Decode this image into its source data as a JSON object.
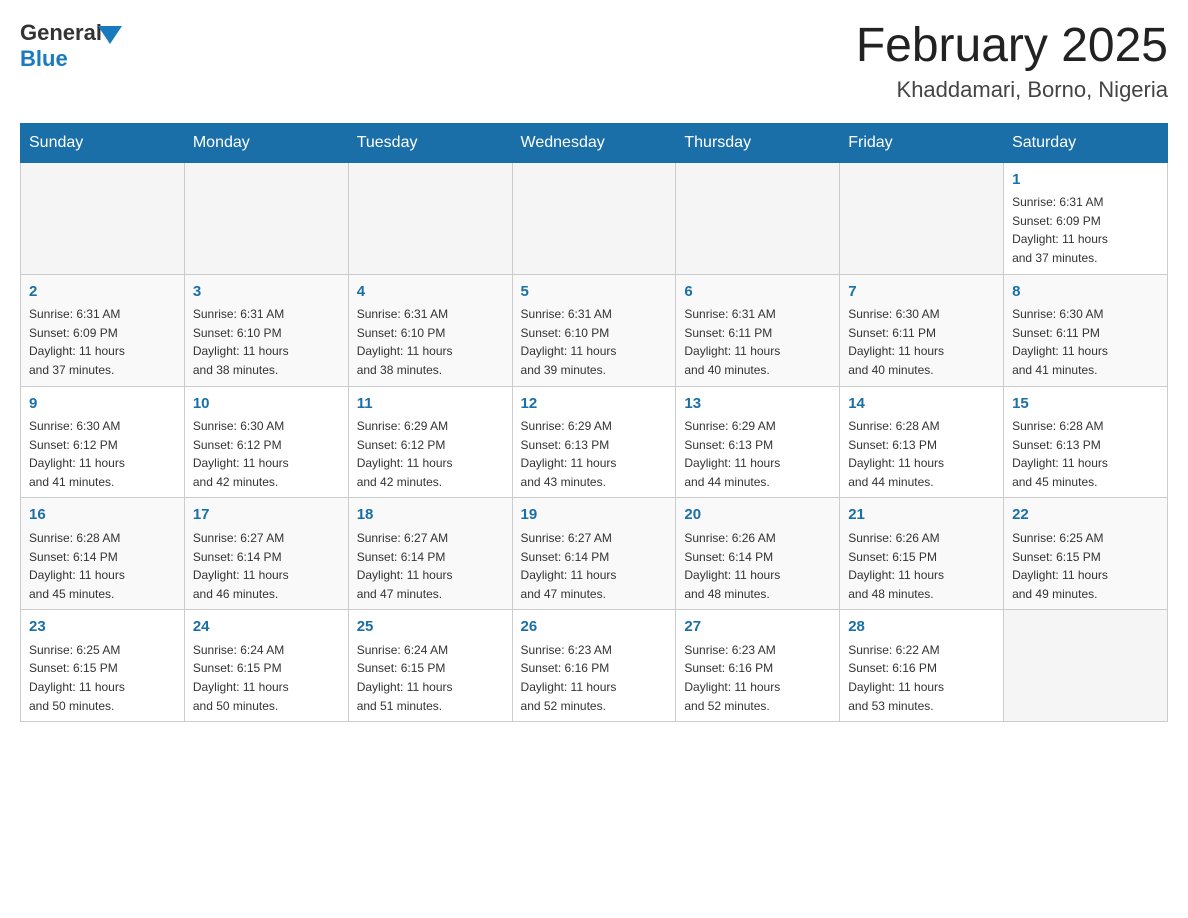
{
  "logo": {
    "general": "General",
    "blue": "Blue"
  },
  "title": "February 2025",
  "location": "Khaddamari, Borno, Nigeria",
  "days_of_week": [
    "Sunday",
    "Monday",
    "Tuesday",
    "Wednesday",
    "Thursday",
    "Friday",
    "Saturday"
  ],
  "weeks": [
    [
      {
        "day": "",
        "info": ""
      },
      {
        "day": "",
        "info": ""
      },
      {
        "day": "",
        "info": ""
      },
      {
        "day": "",
        "info": ""
      },
      {
        "day": "",
        "info": ""
      },
      {
        "day": "",
        "info": ""
      },
      {
        "day": "1",
        "info": "Sunrise: 6:31 AM\nSunset: 6:09 PM\nDaylight: 11 hours\nand 37 minutes."
      }
    ],
    [
      {
        "day": "2",
        "info": "Sunrise: 6:31 AM\nSunset: 6:09 PM\nDaylight: 11 hours\nand 37 minutes."
      },
      {
        "day": "3",
        "info": "Sunrise: 6:31 AM\nSunset: 6:10 PM\nDaylight: 11 hours\nand 38 minutes."
      },
      {
        "day": "4",
        "info": "Sunrise: 6:31 AM\nSunset: 6:10 PM\nDaylight: 11 hours\nand 38 minutes."
      },
      {
        "day": "5",
        "info": "Sunrise: 6:31 AM\nSunset: 6:10 PM\nDaylight: 11 hours\nand 39 minutes."
      },
      {
        "day": "6",
        "info": "Sunrise: 6:31 AM\nSunset: 6:11 PM\nDaylight: 11 hours\nand 40 minutes."
      },
      {
        "day": "7",
        "info": "Sunrise: 6:30 AM\nSunset: 6:11 PM\nDaylight: 11 hours\nand 40 minutes."
      },
      {
        "day": "8",
        "info": "Sunrise: 6:30 AM\nSunset: 6:11 PM\nDaylight: 11 hours\nand 41 minutes."
      }
    ],
    [
      {
        "day": "9",
        "info": "Sunrise: 6:30 AM\nSunset: 6:12 PM\nDaylight: 11 hours\nand 41 minutes."
      },
      {
        "day": "10",
        "info": "Sunrise: 6:30 AM\nSunset: 6:12 PM\nDaylight: 11 hours\nand 42 minutes."
      },
      {
        "day": "11",
        "info": "Sunrise: 6:29 AM\nSunset: 6:12 PM\nDaylight: 11 hours\nand 42 minutes."
      },
      {
        "day": "12",
        "info": "Sunrise: 6:29 AM\nSunset: 6:13 PM\nDaylight: 11 hours\nand 43 minutes."
      },
      {
        "day": "13",
        "info": "Sunrise: 6:29 AM\nSunset: 6:13 PM\nDaylight: 11 hours\nand 44 minutes."
      },
      {
        "day": "14",
        "info": "Sunrise: 6:28 AM\nSunset: 6:13 PM\nDaylight: 11 hours\nand 44 minutes."
      },
      {
        "day": "15",
        "info": "Sunrise: 6:28 AM\nSunset: 6:13 PM\nDaylight: 11 hours\nand 45 minutes."
      }
    ],
    [
      {
        "day": "16",
        "info": "Sunrise: 6:28 AM\nSunset: 6:14 PM\nDaylight: 11 hours\nand 45 minutes."
      },
      {
        "day": "17",
        "info": "Sunrise: 6:27 AM\nSunset: 6:14 PM\nDaylight: 11 hours\nand 46 minutes."
      },
      {
        "day": "18",
        "info": "Sunrise: 6:27 AM\nSunset: 6:14 PM\nDaylight: 11 hours\nand 47 minutes."
      },
      {
        "day": "19",
        "info": "Sunrise: 6:27 AM\nSunset: 6:14 PM\nDaylight: 11 hours\nand 47 minutes."
      },
      {
        "day": "20",
        "info": "Sunrise: 6:26 AM\nSunset: 6:14 PM\nDaylight: 11 hours\nand 48 minutes."
      },
      {
        "day": "21",
        "info": "Sunrise: 6:26 AM\nSunset: 6:15 PM\nDaylight: 11 hours\nand 48 minutes."
      },
      {
        "day": "22",
        "info": "Sunrise: 6:25 AM\nSunset: 6:15 PM\nDaylight: 11 hours\nand 49 minutes."
      }
    ],
    [
      {
        "day": "23",
        "info": "Sunrise: 6:25 AM\nSunset: 6:15 PM\nDaylight: 11 hours\nand 50 minutes."
      },
      {
        "day": "24",
        "info": "Sunrise: 6:24 AM\nSunset: 6:15 PM\nDaylight: 11 hours\nand 50 minutes."
      },
      {
        "day": "25",
        "info": "Sunrise: 6:24 AM\nSunset: 6:15 PM\nDaylight: 11 hours\nand 51 minutes."
      },
      {
        "day": "26",
        "info": "Sunrise: 6:23 AM\nSunset: 6:16 PM\nDaylight: 11 hours\nand 52 minutes."
      },
      {
        "day": "27",
        "info": "Sunrise: 6:23 AM\nSunset: 6:16 PM\nDaylight: 11 hours\nand 52 minutes."
      },
      {
        "day": "28",
        "info": "Sunrise: 6:22 AM\nSunset: 6:16 PM\nDaylight: 11 hours\nand 53 minutes."
      },
      {
        "day": "",
        "info": ""
      }
    ]
  ]
}
